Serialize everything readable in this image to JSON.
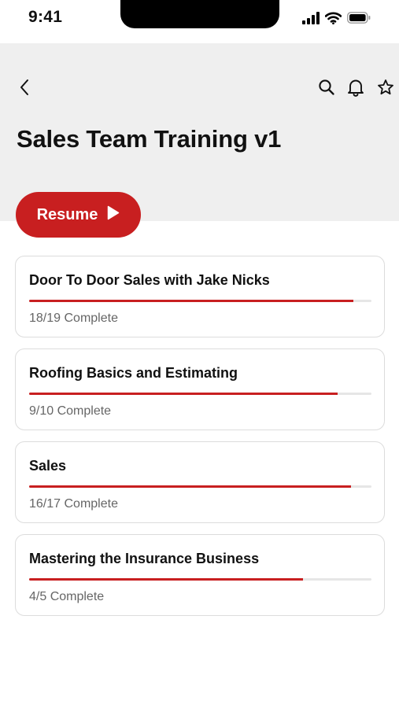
{
  "status_bar": {
    "time": "9:41",
    "icons": [
      "signal-bars-icon",
      "wifi-icon",
      "battery-icon"
    ]
  },
  "nav": {
    "icons": [
      "back-chevron-icon",
      "search-icon",
      "bell-icon",
      "star-icon"
    ]
  },
  "page": {
    "title": "Sales Team Training v1"
  },
  "resume_button": {
    "label": "Resume",
    "icon": "play-icon"
  },
  "colors": {
    "accent": "#c81f20",
    "header_background": "#efefef"
  },
  "courses": [
    {
      "title": "Door To Door Sales with Jake Nicks",
      "status": "18/19 Complete",
      "progress": 0.947
    },
    {
      "title": "Roofing Basics and Estimating",
      "status": "9/10 Complete",
      "progress": 0.9
    },
    {
      "title": "Sales",
      "status": "16/17 Complete",
      "progress": 0.941
    },
    {
      "title": "Mastering the Insurance Business",
      "status": "4/5 Complete",
      "progress": 0.8
    }
  ]
}
